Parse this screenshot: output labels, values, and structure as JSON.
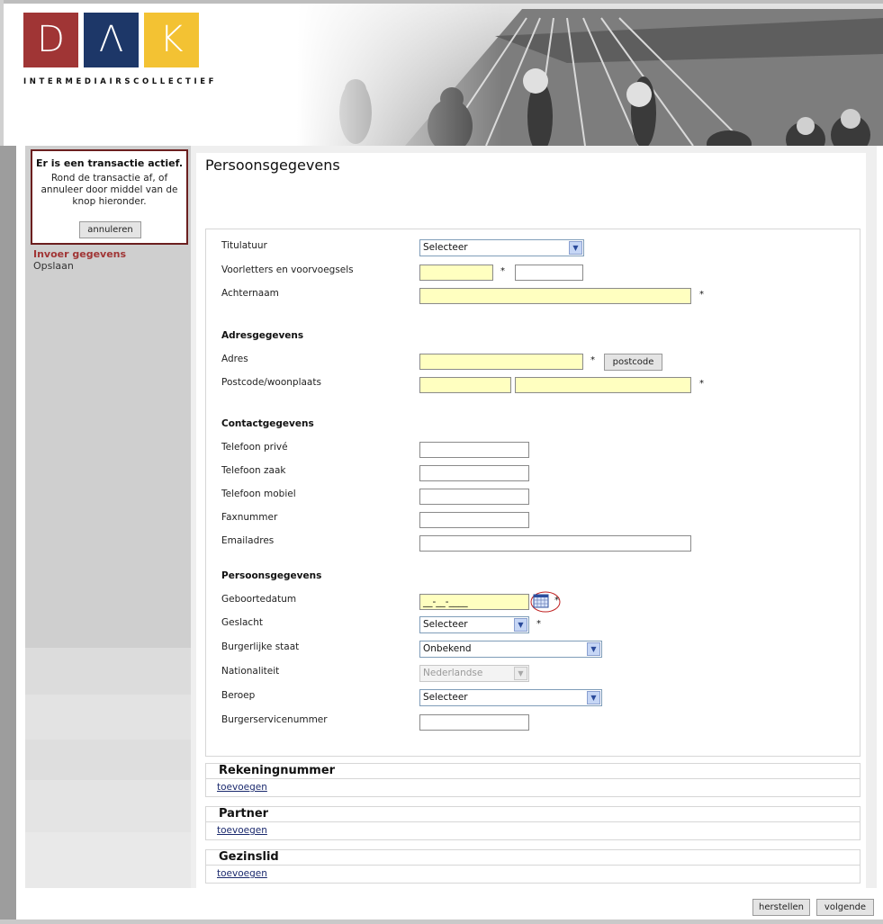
{
  "logo": {
    "letters": [
      "D",
      "Λ",
      "K"
    ],
    "subtitle": "INTERMEDIAIRSCOLLECTIEF",
    "colors": [
      "#a03535",
      "#1d3768",
      "#f3c233"
    ]
  },
  "alert": {
    "title": "Er is een transactie actief.",
    "text": "Rond de transactie af, of annuleer door middel van de knop hieronder.",
    "button": "annuleren"
  },
  "nav": {
    "items": [
      {
        "label": "Invoer gegevens",
        "active": true
      },
      {
        "label": "Opslaan",
        "active": false
      }
    ]
  },
  "page": {
    "title": "Persoonsgegevens"
  },
  "form": {
    "titulatuur": {
      "label": "Titulatuur",
      "value": "Selecteer"
    },
    "voorletters": {
      "label": "Voorletters en voorvoegsels"
    },
    "achternaam": {
      "label": "Achternaam"
    },
    "adres_section": "Adresgegevens",
    "adres": {
      "label": "Adres",
      "button": "postcode"
    },
    "postcode": {
      "label": "Postcode/woonplaats"
    },
    "contact_section": "Contactgegevens",
    "tel_prive": {
      "label": "Telefoon privé"
    },
    "tel_zaak": {
      "label": "Telefoon zaak"
    },
    "tel_mobiel": {
      "label": "Telefoon mobiel"
    },
    "fax": {
      "label": "Faxnummer"
    },
    "email": {
      "label": "Emailadres"
    },
    "persoon_section": "Persoonsgegevens",
    "geboortedatum": {
      "label": "Geboortedatum",
      "value": "__-__-____"
    },
    "geslacht": {
      "label": "Geslacht",
      "value": "Selecteer"
    },
    "burgerlijke_staat": {
      "label": "Burgerlijke staat",
      "value": "Onbekend"
    },
    "nationaliteit": {
      "label": "Nationaliteit",
      "value": "Nederlandse"
    },
    "beroep": {
      "label": "Beroep",
      "value": "Selecteer"
    },
    "bsn": {
      "label": "Burgerservicenummer"
    },
    "required_mark": "*"
  },
  "sections": [
    {
      "title": "Rekeningnummer",
      "link": "toevoegen"
    },
    {
      "title": "Partner",
      "link": "toevoegen"
    },
    {
      "title": "Gezinslid",
      "link": "toevoegen"
    }
  ],
  "footer": {
    "reset": "herstellen",
    "next": "volgende"
  }
}
